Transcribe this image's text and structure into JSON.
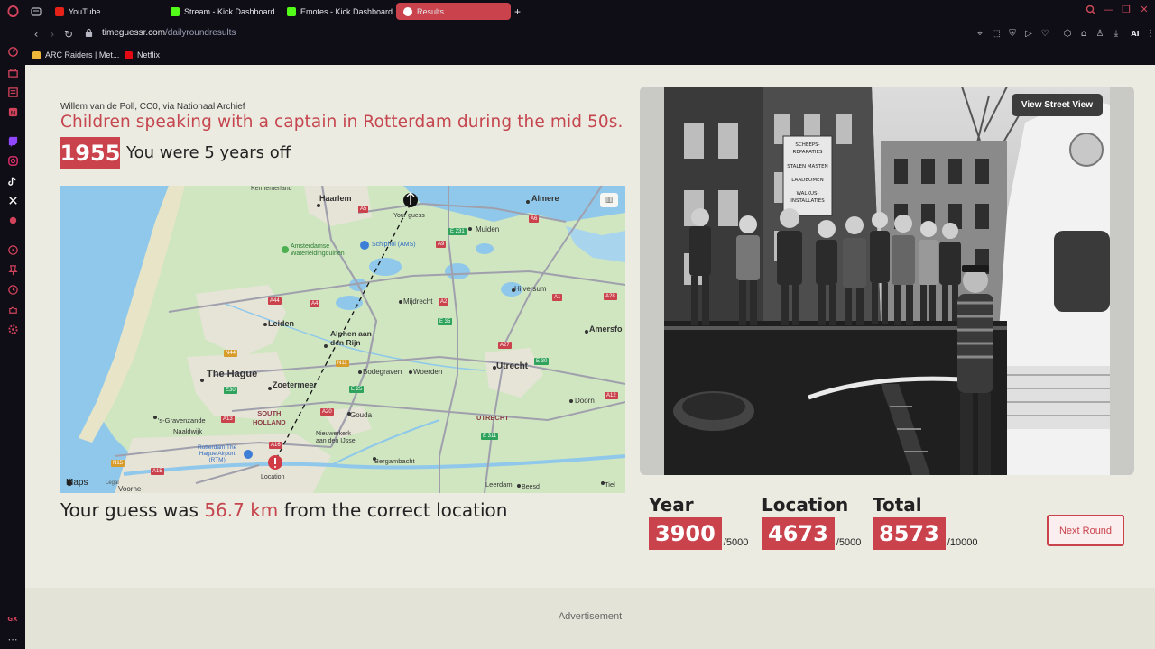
{
  "browser": {
    "tabs": [
      {
        "label": "YouTube",
        "favicon_color": "#e62117"
      },
      {
        "label": "Stream - Kick Dashboard",
        "favicon_color": "#53fc18"
      },
      {
        "label": "Emotes - Kick Dashboard",
        "favicon_color": "#53fc18"
      },
      {
        "label": "Results",
        "favicon_color": "#ffffff",
        "active": true
      }
    ],
    "new_tab_icon": "plus-icon",
    "url_host": "timeguessr.com",
    "url_path": "/dailyroundresults",
    "ai_label": "AI",
    "bookmarks": [
      {
        "label": "ARC Raiders | Met...",
        "favicon_color": "#f0b83a"
      },
      {
        "label": "Netflix",
        "favicon_color": "#e50914"
      }
    ],
    "sidebar_bottom_label": "GX",
    "accent": "#c9424c"
  },
  "result": {
    "credit": "Willem van de Poll, CC0, via Nationaal Archief",
    "caption": "Children speaking with a captain in Rotterdam during the mid 50s.",
    "year": "1955",
    "years_off": "You were 5 years off",
    "distance_prefix": "Your guess was ",
    "distance_value": "56.7 km",
    "distance_suffix": " from the correct location",
    "view_street_view": "View Street View",
    "next_round": "Next Round",
    "advertisement": "Advertisement"
  },
  "map": {
    "places": {
      "kennemerland": "Kennemerland",
      "haarlem": "Haarlem",
      "almere": "Almere",
      "your_guess": "Your guess",
      "muiden": "Muiden",
      "amsterdamse": "Amsterdamse\nWaterleidingduinen",
      "schiphol": "Schiphol (AMS)",
      "hilversum": "Hilversum",
      "mijdrecht": "Mijdrecht",
      "leiden": "Leiden",
      "alphen": "Alphen aan\nden Rijn",
      "amersfoort": "Amersfo",
      "the_hague": "The Hague",
      "zoetermeer": "Zoetermeer",
      "bodegraven": "Bodegraven",
      "woerden": "Woerden",
      "utrecht": "Utrecht",
      "doorn": "Doorn",
      "gravenzande": "'s-Gravenzande",
      "naaldwijk": "Naaldwijk",
      "south_holland": "SOUTH\nHOLLAND",
      "gouda": "Gouda",
      "utrecht_prov": "UTRECHT",
      "rotterdam_airport": "Rotterdam The\nHague Airport\n(RTM)",
      "nieuwerkerk": "Nieuwerkerk\naan den IJssel",
      "bergambacht": "Bergambacht",
      "location": "Location",
      "leerdam": "Leerdam",
      "beesd": "Beesd",
      "tiel": "Tiel",
      "voorne": "Voorne-",
      "maps_brand": "Maps",
      "legal": "Legal"
    },
    "roads": {
      "a5": "A5",
      "a6": "A6",
      "a9": "A9",
      "e231": "E 231",
      "a44": "A44",
      "a4": "A4",
      "a2": "A2",
      "a1": "A1",
      "a28": "A28",
      "e35": "E 35",
      "a27": "A27",
      "n44": "N44",
      "n11": "N11",
      "e30": "E 30",
      "e25": "E 25",
      "a12": "A12",
      "a20": "A20",
      "a13": "A13",
      "a16": "A16",
      "n15": "N15",
      "a15": "A15",
      "e311": "E 311",
      "e30b": "E30"
    }
  },
  "scores": {
    "year": {
      "title": "Year",
      "value": "3900",
      "max": "/5000"
    },
    "location": {
      "title": "Location",
      "value": "4673",
      "max": "/5000"
    },
    "total": {
      "title": "Total",
      "value": "8573",
      "max": "/10000"
    }
  },
  "photo_sign": {
    "line1": "SCHEEPS-",
    "line2": "REPARATIES",
    "line3": "STALEN MASTEN",
    "line4": "LAADBOMEN",
    "line5": "WALKUS-",
    "line6": "INSTALLATIES"
  }
}
